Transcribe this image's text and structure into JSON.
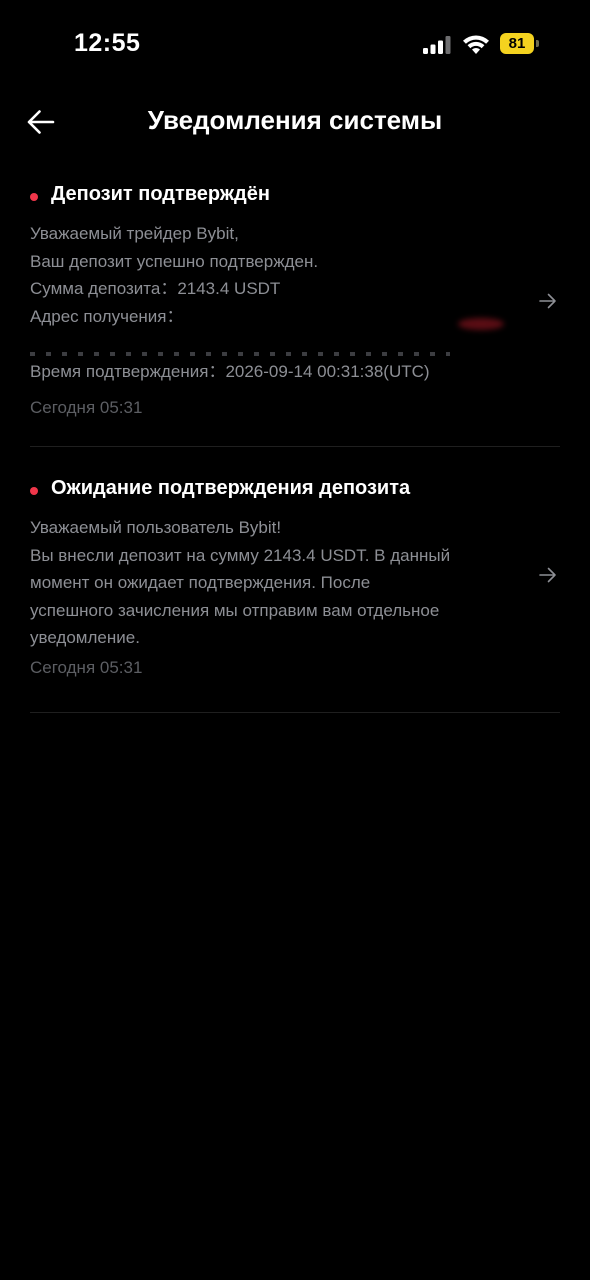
{
  "status_bar": {
    "time": "12:55",
    "battery_level": "81",
    "icons": [
      "cellular-signal-icon",
      "wifi-icon",
      "battery-icon"
    ]
  },
  "header": {
    "title": "Уведомления системы",
    "back_icon": "arrow-left-icon"
  },
  "notifications": [
    {
      "title": "Депозит подтверждён",
      "unread": true,
      "body_lines": [
        "Уважаемый трейдер Bybit,",
        "Ваш депозит успешно подтвержден.",
        "Сумма депозита：2143.4 USDT",
        "Адрес получения："
      ],
      "confirm_line": "Время подтверждения：2026-09-14 00:31:38(UTC)",
      "time": "Сегодня 05:31"
    },
    {
      "title": "Ожидание подтверждения депозита",
      "unread": true,
      "body_lines": [
        "Уважаемый пользователь Bybit!",
        "Вы внесли депозит на сумму 2143.4 USDT. В данный",
        "момент он ожидает подтверждения. После",
        "успешного зачисления мы отправим вам отдельное",
        "уведомление."
      ],
      "time": "Сегодня 05:31"
    }
  ],
  "colors": {
    "background": "#000000",
    "unread_dot": "#f0364a",
    "body_text": "#8d8f95",
    "time_text": "#5c5e63",
    "battery": "#f4d21f"
  }
}
